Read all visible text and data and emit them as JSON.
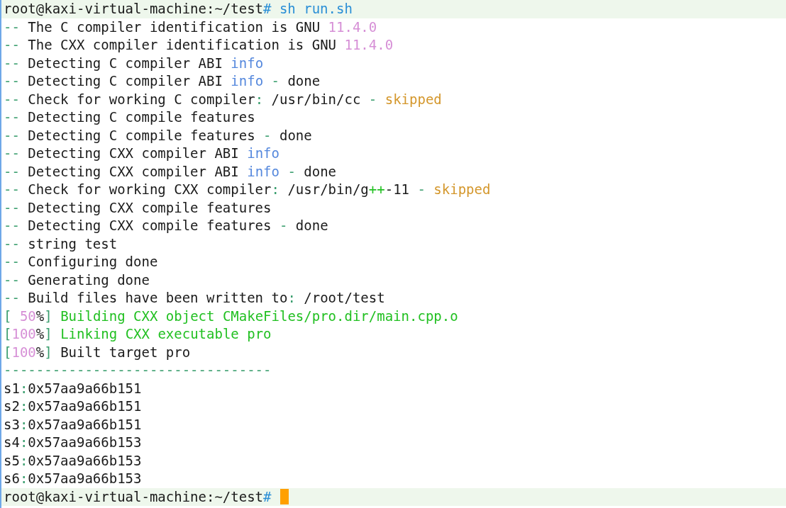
{
  "lines": [
    {
      "highlighted": true,
      "segments": [
        {
          "text": "root@kaxi-virtual-machine:~/test",
          "color": "#1a1a1a"
        },
        {
          "text": "# sh run.sh",
          "color": "#2b8fd6"
        }
      ]
    },
    {
      "highlighted": false,
      "segments": [
        {
          "text": "--",
          "color": "#3a9e6e"
        },
        {
          "text": " The C compiler identification is GNU ",
          "color": "#1a1a1a"
        },
        {
          "text": "11.4.0",
          "color": "#d68fd6"
        }
      ]
    },
    {
      "highlighted": false,
      "segments": [
        {
          "text": "--",
          "color": "#3a9e6e"
        },
        {
          "text": " The CXX compiler identification is GNU ",
          "color": "#1a1a1a"
        },
        {
          "text": "11.4.0",
          "color": "#d68fd6"
        }
      ]
    },
    {
      "highlighted": false,
      "segments": [
        {
          "text": "--",
          "color": "#3a9e6e"
        },
        {
          "text": " Detecting C compiler ABI ",
          "color": "#1a1a1a"
        },
        {
          "text": "info",
          "color": "#5588dd"
        }
      ]
    },
    {
      "highlighted": false,
      "segments": [
        {
          "text": "--",
          "color": "#3a9e6e"
        },
        {
          "text": " Detecting C compiler ABI ",
          "color": "#1a1a1a"
        },
        {
          "text": "info",
          "color": "#5588dd"
        },
        {
          "text": " - ",
          "color": "#3a9e6e"
        },
        {
          "text": "done",
          "color": "#1a1a1a"
        }
      ]
    },
    {
      "highlighted": false,
      "segments": [
        {
          "text": "--",
          "color": "#3a9e6e"
        },
        {
          "text": " Check for working C compiler",
          "color": "#1a1a1a"
        },
        {
          "text": ":",
          "color": "#3a9e6e"
        },
        {
          "text": " /usr/bin/cc ",
          "color": "#1a1a1a"
        },
        {
          "text": "- ",
          "color": "#3a9e6e"
        },
        {
          "text": "skipped",
          "color": "#d4972c"
        }
      ]
    },
    {
      "highlighted": false,
      "segments": [
        {
          "text": "--",
          "color": "#3a9e6e"
        },
        {
          "text": " Detecting C compile features",
          "color": "#1a1a1a"
        }
      ]
    },
    {
      "highlighted": false,
      "segments": [
        {
          "text": "--",
          "color": "#3a9e6e"
        },
        {
          "text": " Detecting C compile features ",
          "color": "#1a1a1a"
        },
        {
          "text": "- ",
          "color": "#3a9e6e"
        },
        {
          "text": "done",
          "color": "#1a1a1a"
        }
      ]
    },
    {
      "highlighted": false,
      "segments": [
        {
          "text": "--",
          "color": "#3a9e6e"
        },
        {
          "text": " Detecting CXX compiler ABI ",
          "color": "#1a1a1a"
        },
        {
          "text": "info",
          "color": "#5588dd"
        }
      ]
    },
    {
      "highlighted": false,
      "segments": [
        {
          "text": "--",
          "color": "#3a9e6e"
        },
        {
          "text": " Detecting CXX compiler ABI ",
          "color": "#1a1a1a"
        },
        {
          "text": "info",
          "color": "#5588dd"
        },
        {
          "text": " - ",
          "color": "#3a9e6e"
        },
        {
          "text": "done",
          "color": "#1a1a1a"
        }
      ]
    },
    {
      "highlighted": false,
      "segments": [
        {
          "text": "--",
          "color": "#3a9e6e"
        },
        {
          "text": " Check for working CXX compiler",
          "color": "#1a1a1a"
        },
        {
          "text": ":",
          "color": "#3a9e6e"
        },
        {
          "text": " /usr/bin/g",
          "color": "#1a1a1a"
        },
        {
          "text": "++",
          "color": "#22c022"
        },
        {
          "text": "-11 ",
          "color": "#1a1a1a"
        },
        {
          "text": "- ",
          "color": "#3a9e6e"
        },
        {
          "text": "skipped",
          "color": "#d4972c"
        }
      ]
    },
    {
      "highlighted": false,
      "segments": [
        {
          "text": "--",
          "color": "#3a9e6e"
        },
        {
          "text": " Detecting CXX compile features",
          "color": "#1a1a1a"
        }
      ]
    },
    {
      "highlighted": false,
      "segments": [
        {
          "text": "--",
          "color": "#3a9e6e"
        },
        {
          "text": " Detecting CXX compile features ",
          "color": "#1a1a1a"
        },
        {
          "text": "- ",
          "color": "#3a9e6e"
        },
        {
          "text": "done",
          "color": "#1a1a1a"
        }
      ]
    },
    {
      "highlighted": false,
      "segments": [
        {
          "text": "--",
          "color": "#3a9e6e"
        },
        {
          "text": " string test",
          "color": "#1a1a1a"
        }
      ]
    },
    {
      "highlighted": false,
      "segments": [
        {
          "text": "--",
          "color": "#3a9e6e"
        },
        {
          "text": " Configuring done",
          "color": "#1a1a1a"
        }
      ]
    },
    {
      "highlighted": false,
      "segments": [
        {
          "text": "--",
          "color": "#3a9e6e"
        },
        {
          "text": " Generating done",
          "color": "#1a1a1a"
        }
      ]
    },
    {
      "highlighted": false,
      "segments": [
        {
          "text": "--",
          "color": "#3a9e6e"
        },
        {
          "text": " Build files have been written to",
          "color": "#1a1a1a"
        },
        {
          "text": ":",
          "color": "#3a9e6e"
        },
        {
          "text": " /root/test",
          "color": "#1a1a1a"
        }
      ]
    },
    {
      "highlighted": false,
      "segments": [
        {
          "text": "[",
          "color": "#3a9e6e"
        },
        {
          "text": " 50",
          "color": "#d68fd6"
        },
        {
          "text": "%",
          "color": "#1a1a1a"
        },
        {
          "text": "]",
          "color": "#3a9e6e"
        },
        {
          "text": " Building CXX object CMakeFiles/pro.dir/main.cpp.o",
          "color": "#22c022"
        }
      ]
    },
    {
      "highlighted": false,
      "segments": [
        {
          "text": "[",
          "color": "#3a9e6e"
        },
        {
          "text": "100",
          "color": "#d68fd6"
        },
        {
          "text": "%",
          "color": "#1a1a1a"
        },
        {
          "text": "]",
          "color": "#3a9e6e"
        },
        {
          "text": " Linking CXX executable pro",
          "color": "#22c022"
        }
      ]
    },
    {
      "highlighted": false,
      "segments": [
        {
          "text": "[",
          "color": "#3a9e6e"
        },
        {
          "text": "100",
          "color": "#d68fd6"
        },
        {
          "text": "%",
          "color": "#1a1a1a"
        },
        {
          "text": "]",
          "color": "#3a9e6e"
        },
        {
          "text": " Built target pro",
          "color": "#1a1a1a"
        }
      ]
    },
    {
      "highlighted": false,
      "segments": [
        {
          "text": "---------------------------------",
          "color": "#3a9e6e"
        }
      ]
    },
    {
      "highlighted": false,
      "segments": [
        {
          "text": "s1",
          "color": "#1a1a1a"
        },
        {
          "text": ":",
          "color": "#3a9e6e"
        },
        {
          "text": "0x57aa9a66b151",
          "color": "#1a1a1a"
        }
      ]
    },
    {
      "highlighted": false,
      "segments": [
        {
          "text": "s2",
          "color": "#1a1a1a"
        },
        {
          "text": ":",
          "color": "#3a9e6e"
        },
        {
          "text": "0x57aa9a66b151",
          "color": "#1a1a1a"
        }
      ]
    },
    {
      "highlighted": false,
      "segments": [
        {
          "text": "s3",
          "color": "#1a1a1a"
        },
        {
          "text": ":",
          "color": "#3a9e6e"
        },
        {
          "text": "0x57aa9a66b151",
          "color": "#1a1a1a"
        }
      ]
    },
    {
      "highlighted": false,
      "segments": [
        {
          "text": "s4",
          "color": "#1a1a1a"
        },
        {
          "text": ":",
          "color": "#3a9e6e"
        },
        {
          "text": "0x57aa9a66b153",
          "color": "#1a1a1a"
        }
      ]
    },
    {
      "highlighted": false,
      "segments": [
        {
          "text": "s5",
          "color": "#1a1a1a"
        },
        {
          "text": ":",
          "color": "#3a9e6e"
        },
        {
          "text": "0x57aa9a66b153",
          "color": "#1a1a1a"
        }
      ]
    },
    {
      "highlighted": false,
      "segments": [
        {
          "text": "s6",
          "color": "#1a1a1a"
        },
        {
          "text": ":",
          "color": "#3a9e6e"
        },
        {
          "text": "0x57aa9a66b153",
          "color": "#1a1a1a"
        }
      ]
    }
  ],
  "prompt": {
    "highlighted": true,
    "cursor": true,
    "segments": [
      {
        "text": "root@kaxi-virtual-machine:~/test",
        "color": "#1a1a1a"
      },
      {
        "text": "#",
        "color": "#2b8fd6"
      }
    ]
  }
}
